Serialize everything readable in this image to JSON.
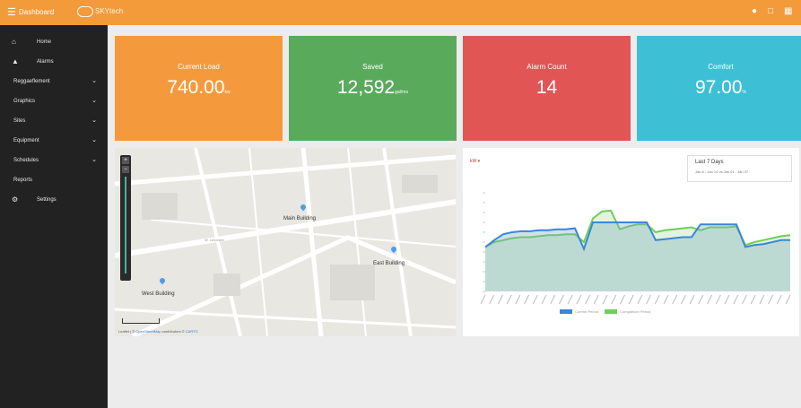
{
  "topbar": {
    "title": "Dashboard",
    "brand": "SKYtech"
  },
  "sidebar": {
    "items": [
      {
        "label": "Home",
        "icon": "home-icon",
        "chevron": false
      },
      {
        "label": "Alarms",
        "icon": "bell-icon",
        "chevron": false
      },
      {
        "label": "Reggaeflement",
        "chevron": true
      },
      {
        "label": "Graphics",
        "chevron": true
      },
      {
        "label": "Sites",
        "chevron": true
      },
      {
        "label": "Equipment",
        "chevron": true
      },
      {
        "label": "Schedules",
        "chevron": true
      },
      {
        "label": "Reports",
        "chevron": false
      },
      {
        "label": "Settings",
        "icon": "gear-icon",
        "chevron": false
      }
    ]
  },
  "cards": [
    {
      "label": "Current Load",
      "value": "740.00",
      "unit": "kw",
      "color": "#f49a3c"
    },
    {
      "label": "Saved",
      "value": "12,592",
      "unit": "gal/mo",
      "color": "#5aaa5c"
    },
    {
      "label": "Alarm Count",
      "value": "14",
      "unit": "",
      "color": "#e15555"
    },
    {
      "label": "Comfort",
      "value": "97.00",
      "unit": "%",
      "color": "#3dbfd6"
    }
  ],
  "map": {
    "labels": [
      "Main Building",
      "East Building",
      "West Building",
      "W. Leicester"
    ],
    "attribution": {
      "prefix": "Leaflet",
      "link1": "OpenStreetMap",
      "mid": "contributors",
      "link2": "CARTO"
    }
  },
  "chart_panel": {
    "selector": "kW",
    "date_range": {
      "title": "Last 7 Days",
      "sub": "Jan 8 - Jan 14 vs Jan 01 - Jan 07"
    },
    "legend": [
      "Current Period",
      "Comparison Period"
    ],
    "colors": {
      "blue": "#3a86d8",
      "green": "#6fcf5c"
    }
  },
  "chart_data": {
    "type": "area",
    "title": "",
    "xlabel": "",
    "ylabel": "",
    "ylim": [
      0,
      100
    ],
    "series": [
      {
        "name": "Current Period",
        "values": [
          45,
          52,
          58,
          60,
          61,
          61,
          62,
          62,
          63,
          63,
          64,
          43,
          70,
          70,
          70,
          70,
          70,
          70,
          70,
          52,
          53,
          54,
          55,
          55,
          68,
          68,
          68,
          68,
          68,
          45,
          47,
          48,
          50,
          52,
          52
        ]
      },
      {
        "name": "Comparison Period",
        "values": [
          45,
          50,
          52,
          54,
          55,
          55,
          56,
          57,
          57,
          58,
          58,
          50,
          74,
          81,
          82,
          63,
          66,
          68,
          68,
          60,
          62,
          63,
          64,
          65,
          62,
          65,
          65,
          65,
          66,
          47,
          50,
          52,
          54,
          56,
          57
        ]
      }
    ],
    "grid": false,
    "legend_position": "bottom"
  }
}
